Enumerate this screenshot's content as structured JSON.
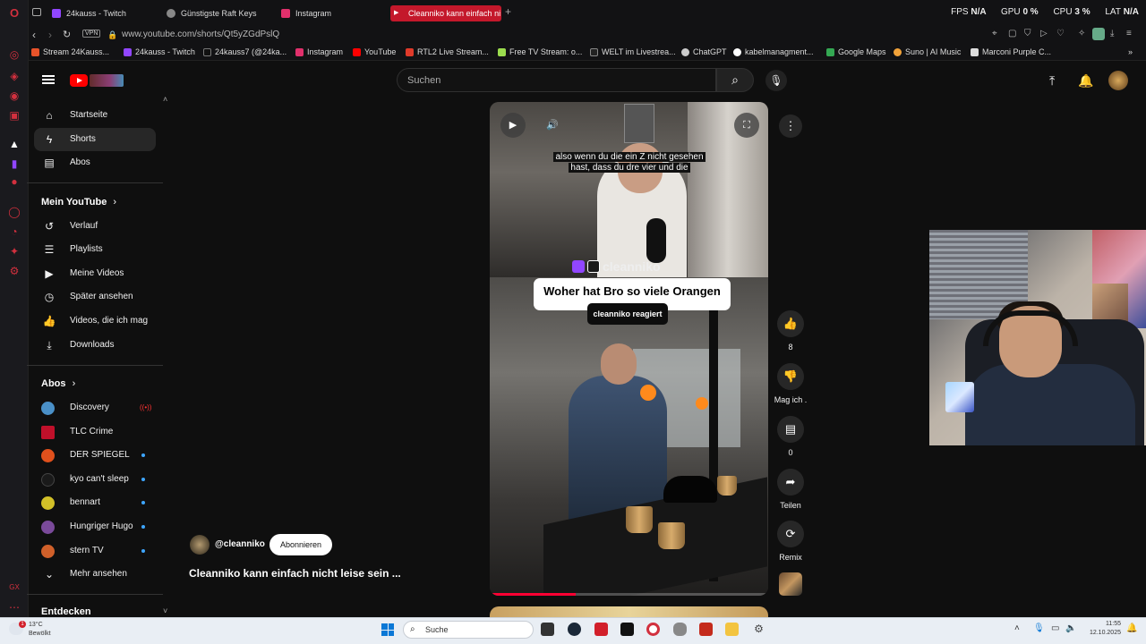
{
  "browser": {
    "tabs": [
      {
        "label": "24kauss - Twitch",
        "color": "#9146ff"
      },
      {
        "label": "Günstigste Raft Keys",
        "color": "#888888"
      },
      {
        "label": "Instagram",
        "color": "#e1306c"
      },
      {
        "label": "Cleanniko kann einfach ni",
        "color": "#ff0000",
        "active": true
      }
    ],
    "new_tab": "+",
    "stats": {
      "fps_label": "FPS",
      "fps": "N/A",
      "gpu_label": "GPU",
      "gpu": "0 %",
      "cpu_label": "CPU",
      "cpu": "3 %",
      "lat_label": "LAT",
      "lat": "N/A"
    },
    "vpn": "VPN",
    "url": "www.youtube.com/shorts/Qt5yZGdPslQ",
    "bookmarks": [
      {
        "label": "Stream 24Kauss...",
        "color": "#e8532a"
      },
      {
        "label": "24kauss - Twitch",
        "color": "#9146ff"
      },
      {
        "label": "24kauss7 (@24ka...",
        "color": "#111111"
      },
      {
        "label": "Instagram",
        "color": "#e1306c"
      },
      {
        "label": "YouTube",
        "color": "#ff0000"
      },
      {
        "label": "RTL2 Live Stream...",
        "color": "#e03a2a"
      },
      {
        "label": "Free TV Stream: o...",
        "color": "#9bdc4e"
      },
      {
        "label": "WELT im Livestrea...",
        "color": "#222222"
      },
      {
        "label": "ChatGPT",
        "color": "#cccccc"
      },
      {
        "label": "kabelmanagment...",
        "color": "#ffffff"
      },
      {
        "label": "Google Maps",
        "color": "#34a853"
      },
      {
        "label": "Suno | AI Music",
        "color": "#f2a33a"
      },
      {
        "label": "Marconi Purple C...",
        "color": "#dddddd"
      }
    ]
  },
  "youtube": {
    "search_placeholder": "Suchen",
    "sidebar": {
      "main": [
        {
          "label": "Startseite",
          "icon": "home-icon",
          "glyph": "⌂"
        },
        {
          "label": "Shorts",
          "icon": "shorts-icon",
          "glyph": "ϟ",
          "selected": true
        },
        {
          "label": "Abos",
          "icon": "subscriptions-icon",
          "glyph": "▤"
        }
      ],
      "you_header": "Mein YouTube",
      "you": [
        {
          "label": "Verlauf",
          "icon": "history-icon",
          "glyph": "↺"
        },
        {
          "label": "Playlists",
          "icon": "playlists-icon",
          "glyph": "☰"
        },
        {
          "label": "Meine Videos",
          "icon": "my-videos-icon",
          "glyph": "▶"
        },
        {
          "label": "Später ansehen",
          "icon": "watch-later-icon",
          "glyph": "◷"
        },
        {
          "label": "Videos, die ich mag",
          "icon": "liked-videos-icon",
          "glyph": "👍"
        },
        {
          "label": "Downloads",
          "icon": "downloads-icon",
          "glyph": "⤓"
        }
      ],
      "subs_header": "Abos",
      "subs": [
        {
          "label": "Discovery",
          "color": "#4a90c8",
          "indicator": "live"
        },
        {
          "label": "TLC Crime",
          "color": "#c0102a",
          "indicator": ""
        },
        {
          "label": "DER SPIEGEL",
          "color": "#e0501c",
          "indicator": "dot"
        },
        {
          "label": "kyo can't sleep",
          "color": "#1a1a1a",
          "indicator": "dot"
        },
        {
          "label": "bennart",
          "color": "#d2c028",
          "indicator": "dot"
        },
        {
          "label": "Hungriger Hugo",
          "color": "#7a4a9a",
          "indicator": "dot"
        },
        {
          "label": "stern TV",
          "color": "#d0602a",
          "indicator": "dot"
        }
      ],
      "more": "Mehr ansehen",
      "explore_header": "Entdecken"
    },
    "short": {
      "caption_line1": "also wenn du die ein Z nicht gesehen",
      "caption_line2": "hast, dass du dre vier und die",
      "brand": "cleanniko",
      "title_bubble": "Woher hat Bro so viele Orangen ???",
      "react_bubble": "cleanniko reagiert",
      "progress_fraction": 0.31
    },
    "actions": {
      "like_count": "8",
      "dislike_label": "Mag ich .",
      "comment_count": "0",
      "share_label": "Teilen",
      "remix_label": "Remix"
    },
    "channel": {
      "handle": "@cleanniko",
      "subscribe": "Abonnieren",
      "video_title": "Cleanniko kann einfach nicht leise sein ..."
    }
  },
  "taskbar": {
    "weather_temp": "13°C",
    "weather_desc": "Bewölkt",
    "notif_count": "1",
    "search": "Suche",
    "time": "11:55",
    "date": "12.10.2025"
  }
}
